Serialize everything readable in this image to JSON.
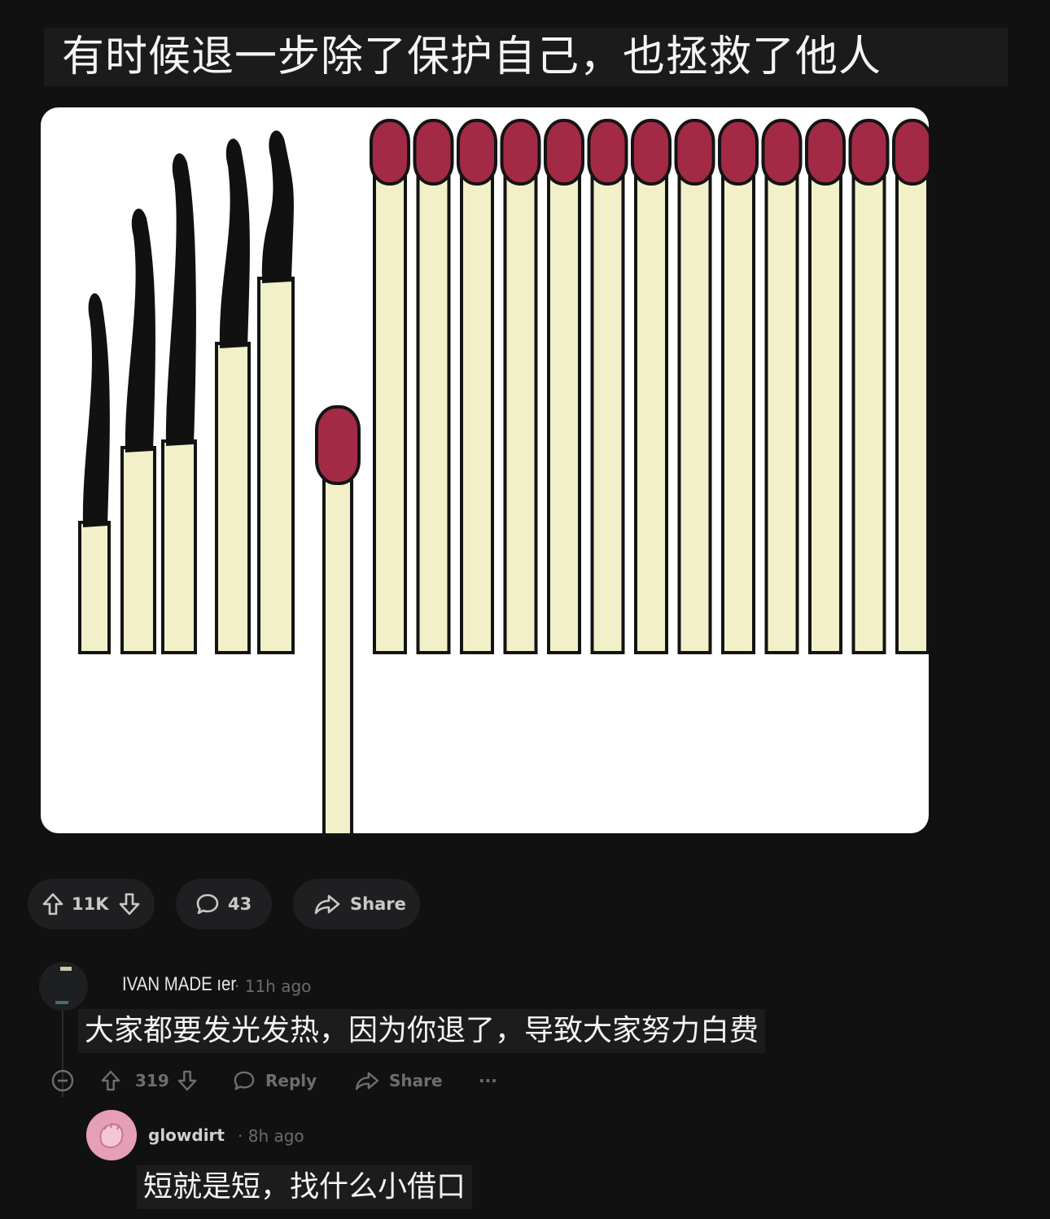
{
  "post": {
    "caption": "有时候退一步除了保护自己，也拯救了他人",
    "image_alt_icon": "matches-illustration",
    "vote_count": "11K",
    "comment_count": "43",
    "share_label": "Share"
  },
  "comments": [
    {
      "author": "IVAN MADE ",
      "author_suffix": "ıer",
      "time": "11h ago",
      "body": "大家都要发光发热，因为你退了，导致大家努力白费",
      "vote_count": "319",
      "reply_label": "Reply",
      "share_label": "Share",
      "more_label": "···"
    },
    {
      "author": "glowdirt",
      "time": "8h ago",
      "body": "短就是短，找什么小借口"
    }
  ],
  "colors": {
    "background": "#111112",
    "match_head": "#a32a45",
    "match_stick": "#f2f0c8",
    "burnt": "#111111",
    "avatar_pink": "#e59fb6"
  },
  "icons": {
    "upvote": "arrow-up-icon",
    "downvote": "arrow-down-icon",
    "comment": "speech-bubble-icon",
    "share": "share-arrow-icon",
    "collapse": "minus-circle-icon"
  }
}
